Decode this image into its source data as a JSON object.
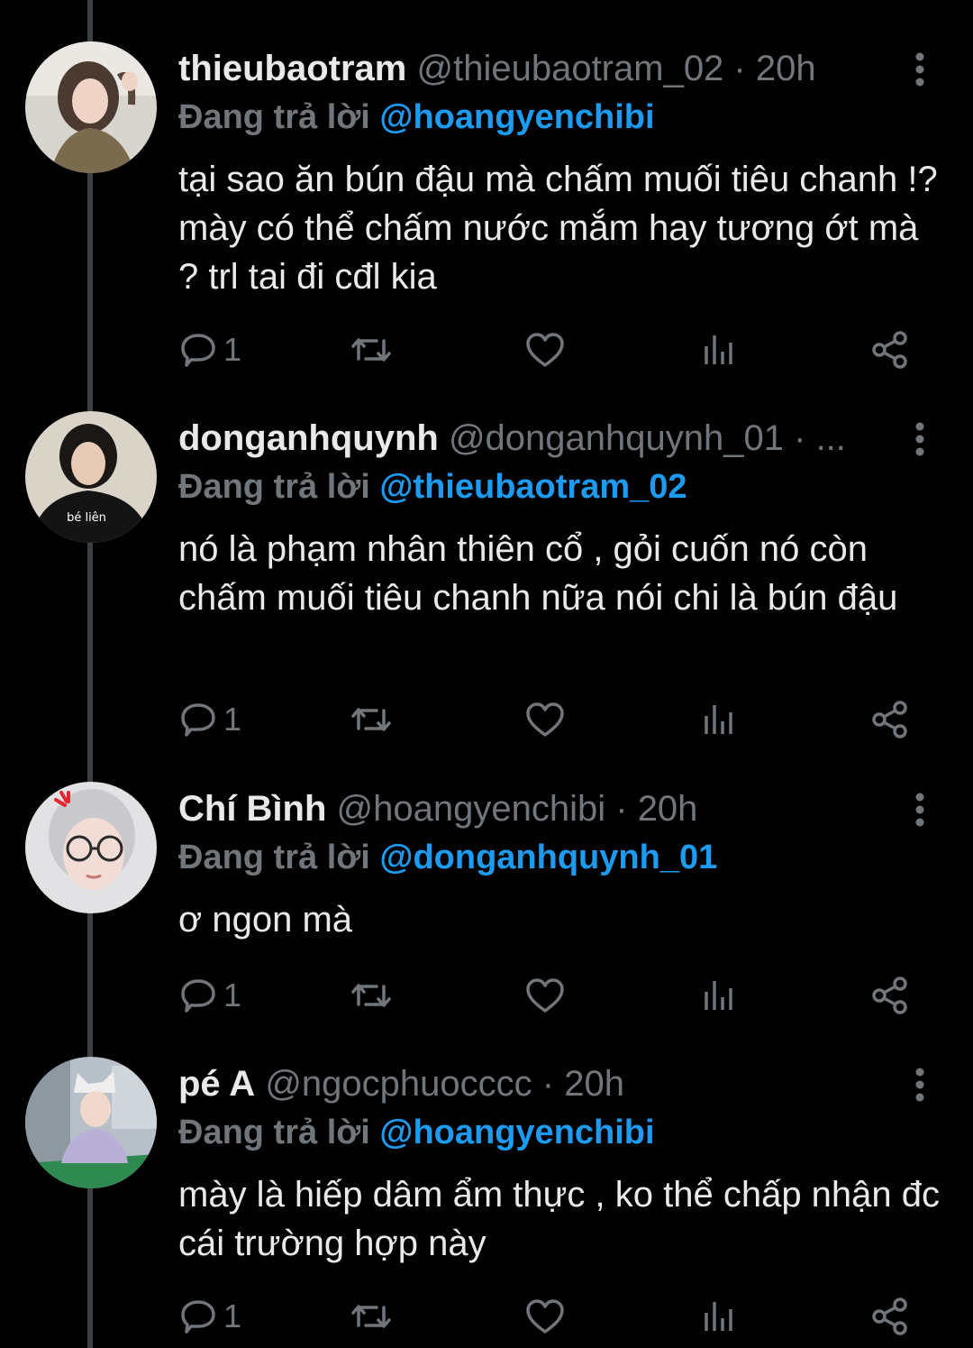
{
  "replies": [
    {
      "display_name": "thieubaotram",
      "handle": "@thieubaotram_02",
      "separator": " · ",
      "time": "20h",
      "reply_prefix": "Đang trả lời ",
      "reply_handle": "@hoangyenchibi",
      "text": "tại sao ăn bún đậu mà chấm muối tiêu chanh !? mày có thể chấm nước mắm hay tương ớt mà ? trl tai đi cđl kia",
      "reply_count": "1"
    },
    {
      "display_name": "donganhquynh",
      "handle": "@donganhquynh_01",
      "separator": " · ",
      "time": "...",
      "reply_prefix": "Đang trả lời ",
      "reply_handle": "@thieubaotram_02",
      "text": "nó là phạm nhân thiên cổ , gỏi cuốn nó còn chấm muối tiêu chanh nữa nói chi là bún đậu",
      "reply_count": "1",
      "avatar_shirt_text": "bé liên"
    },
    {
      "display_name": "Chí Bình",
      "handle": "@hoangyenchibi",
      "separator": " · ",
      "time": "20h",
      "reply_prefix": "Đang trả lời ",
      "reply_handle": "@donganhquynh_01",
      "text": "ơ ngon mà",
      "reply_count": "1"
    },
    {
      "display_name": "pé A",
      "handle": "@ngocphuocccc",
      "separator": " · ",
      "time": "20h",
      "reply_prefix": "Đang trả lời ",
      "reply_handle": "@hoangyenchibi",
      "text": "mày là hiếp dâm ẩm thực , ko thể chấp nhận đc cái trường hợp này",
      "reply_count": "1"
    }
  ],
  "icons": {
    "reply": "speech-bubble-icon",
    "retweet": "retweet-icon",
    "like": "heart-icon",
    "views": "bar-chart-icon",
    "share": "share-icon",
    "more": "vertical-dots-icon"
  },
  "colors": {
    "background": "#000000",
    "text": "#e7e9ea",
    "secondary": "#71767b",
    "accent": "#1d9bf0",
    "thread_line": "#3a3f44"
  }
}
